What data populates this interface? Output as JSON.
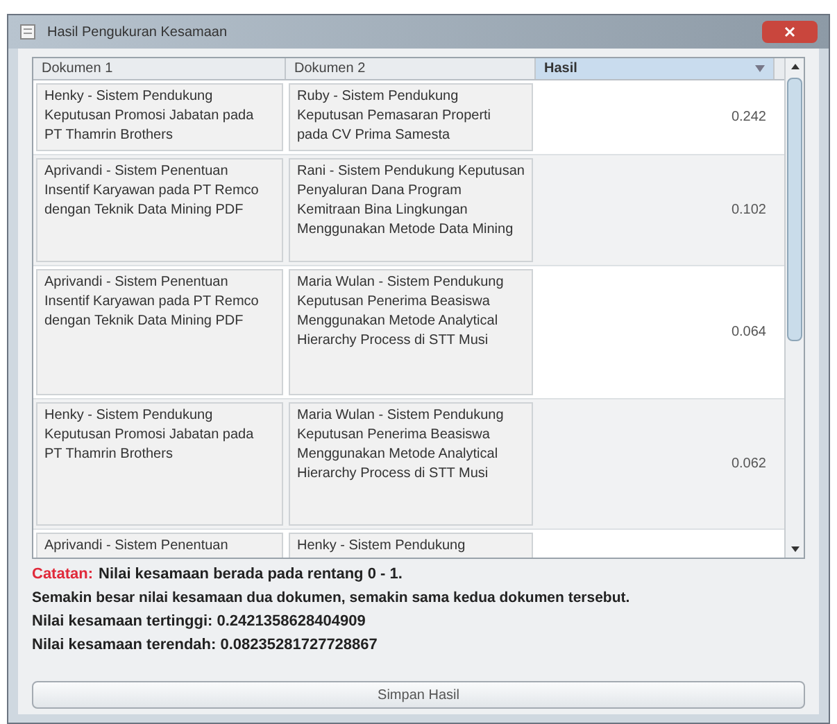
{
  "window": {
    "title": "Hasil Pengukuran Kesamaan"
  },
  "table": {
    "columns": [
      {
        "label": "Dokumen 1",
        "sorted": false
      },
      {
        "label": "Dokumen 2",
        "sorted": false
      },
      {
        "label": "Hasil",
        "sorted": true
      }
    ],
    "rows": [
      {
        "dokumen_1": "Henky - Sistem Pendukung Keputusan Promosi Jabatan pada PT Thamrin Brothers",
        "dokumen_2": "Ruby - Sistem Pendukung Keputusan Pemasaran Properti pada CV Prima Samesta",
        "hasil": "0.242"
      },
      {
        "dokumen_1": "Aprivandi - Sistem Penentuan Insentif Karyawan pada PT Remco dengan Teknik Data Mining PDF",
        "dokumen_2": "Rani - Sistem Pendukung Keputusan Penyaluran Dana Program Kemitraan Bina Lingkungan Menggunakan Metode Data Mining",
        "hasil": "0.102"
      },
      {
        "dokumen_1": "Aprivandi - Sistem Penentuan Insentif Karyawan pada PT Remco dengan Teknik Data Mining PDF",
        "dokumen_2": "Maria Wulan - Sistem Pendukung Keputusan Penerima Beasiswa Menggunakan Metode Analytical Hierarchy Process di STT Musi",
        "hasil": "0.064"
      },
      {
        "dokumen_1": "Henky - Sistem Pendukung Keputusan Promosi Jabatan pada PT Thamrin Brothers",
        "dokumen_2": "Maria Wulan - Sistem Pendukung Keputusan Penerima Beasiswa Menggunakan Metode Analytical Hierarchy Process di STT Musi",
        "hasil": "0.062"
      },
      {
        "dokumen_1": "Aprivandi - Sistem Penentuan",
        "dokumen_2": "Henky - Sistem Pendukung"
      }
    ]
  },
  "notes": {
    "label": "Catatan:",
    "range": "Nilai kesamaan berada pada rentang 0 - 1.",
    "explanation": "Semakin besar nilai kesamaan dua dokumen, semakin sama kedua dokumen tersebut.",
    "highest": "Nilai kesamaan tertinggi: 0.2421358628404909",
    "lowest": "Nilai kesamaan terendah: 0.08235281727728867"
  },
  "buttons": [
    "Simpan Hasil"
  ]
}
